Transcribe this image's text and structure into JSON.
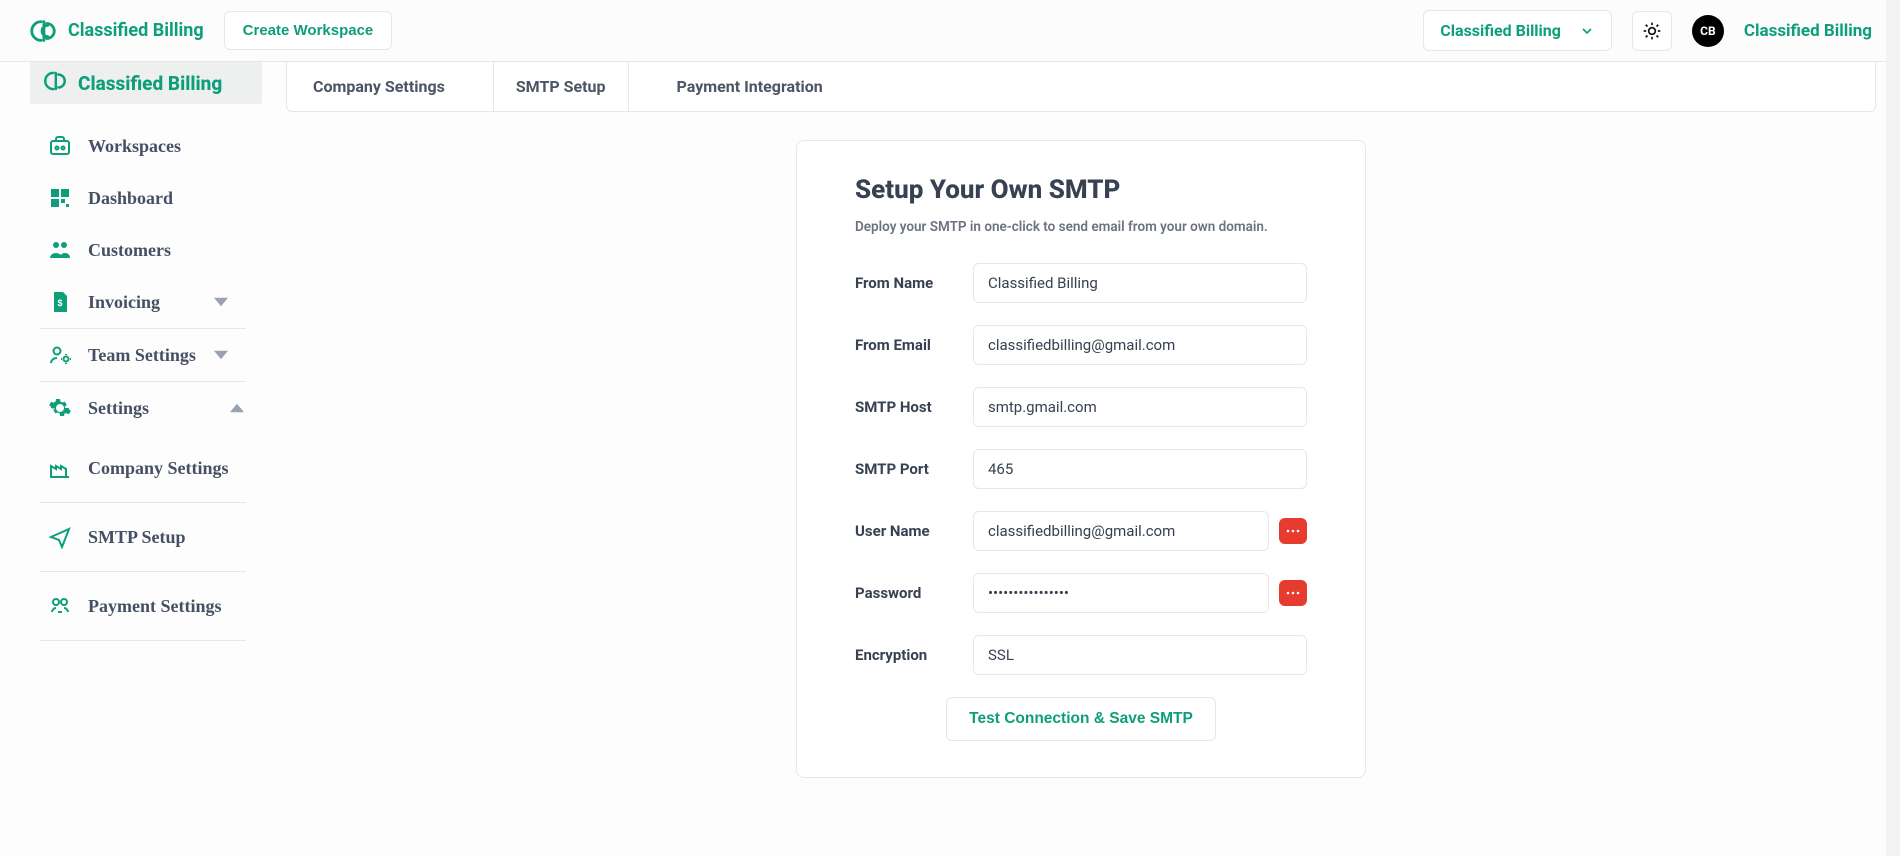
{
  "header": {
    "brand": "Classified Billing",
    "create_workspace_label": "Create Workspace",
    "workspace_selector": "Classified Billing",
    "avatar_initials": "CB",
    "user_name": "Classified Billing"
  },
  "sidebar": {
    "header": "Classified Billing",
    "items": [
      {
        "label": "Workspaces"
      },
      {
        "label": "Dashboard"
      },
      {
        "label": "Customers"
      },
      {
        "label": "Invoicing"
      },
      {
        "label": "Team Settings"
      },
      {
        "label": "Settings"
      },
      {
        "label": "Company Settings"
      },
      {
        "label": "SMTP Setup"
      },
      {
        "label": "Payment Settings"
      }
    ]
  },
  "tabs": {
    "company": "Company Settings",
    "smtp": "SMTP Setup",
    "payment": "Payment Integration"
  },
  "form": {
    "title": "Setup Your Own SMTP",
    "subtitle": "Deploy your SMTP in one-click to send email from your own domain.",
    "labels": {
      "from_name": "From Name",
      "from_email": "From Email",
      "smtp_host": "SMTP Host",
      "smtp_port": "SMTP Port",
      "user_name": "User Name",
      "password": "Password",
      "encryption": "Encryption"
    },
    "values": {
      "from_name": "Classified Billing",
      "from_email": "classifiedbilling@gmail.com",
      "smtp_host": "smtp.gmail.com",
      "smtp_port": "465",
      "user_name": "classifiedbilling@gmail.com",
      "password": "••••••••••••••••",
      "encryption": "SSL"
    },
    "submit_label": "Test Connection & Save SMTP"
  }
}
